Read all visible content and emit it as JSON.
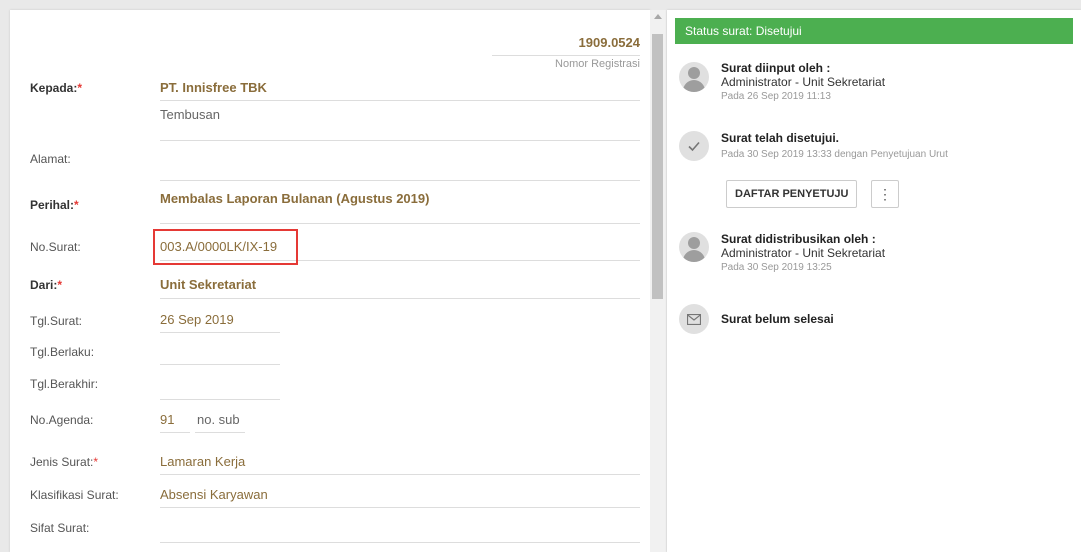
{
  "registration": {
    "number": "1909.0524",
    "label": "Nomor Registrasi"
  },
  "form": {
    "kepada_label": "Kepada:",
    "kepada_value": "PT. Innisfree TBK",
    "tembusan_placeholder": "Tembusan",
    "alamat_label": "Alamat:",
    "perihal_label": "Perihal:",
    "perihal_value": "Membalas Laporan Bulanan (Agustus 2019)",
    "nosurat_label": "No.Surat:",
    "nosurat_value": "003.A/0000LK/IX-19",
    "dari_label": "Dari:",
    "dari_value": "Unit Sekretariat",
    "tglsurat_label": "Tgl.Surat:",
    "tglsurat_value": "26 Sep 2019",
    "tglberlaku_label": "Tgl.Berlaku:",
    "tglberakhir_label": "Tgl.Berakhir:",
    "noagenda_label": "No.Agenda:",
    "noagenda_value": "91",
    "nosub_placeholder": "no. sub",
    "jenis_label": "Jenis Surat:",
    "jenis_value": "Lamaran Kerja",
    "klasifikasi_label": "Klasifikasi Surat:",
    "klasifikasi_value": "Absensi Karyawan",
    "sifat_label": "Sifat Surat:",
    "required_mark": "*"
  },
  "status": {
    "header": "Status surat: Disetujui",
    "items": [
      {
        "title": "Surat diinput oleh :",
        "sub": "Administrator - Unit Sekretariat",
        "time": "Pada 26 Sep 2019 11:13"
      },
      {
        "title": "Surat telah disetujui.",
        "time": "Pada 30 Sep 2019 13:33 dengan Penyetujuan Urut"
      },
      {
        "title": "Surat didistribusikan oleh :",
        "sub": "Administrator - Unit Sekretariat",
        "time": "Pada 30 Sep 2019 13:25"
      },
      {
        "title": "Surat belum selesai"
      }
    ],
    "approvers_button": "DAFTAR PENYETUJU",
    "more_button": "⋮"
  },
  "colors": {
    "accent_green": "#4caf50",
    "value_brown": "#8a6d3b",
    "required_red": "#e53935"
  },
  "icons": {
    "user": "avatar-icon",
    "check": "check-icon",
    "mail": "mail-icon",
    "more": "more-vert-icon"
  }
}
